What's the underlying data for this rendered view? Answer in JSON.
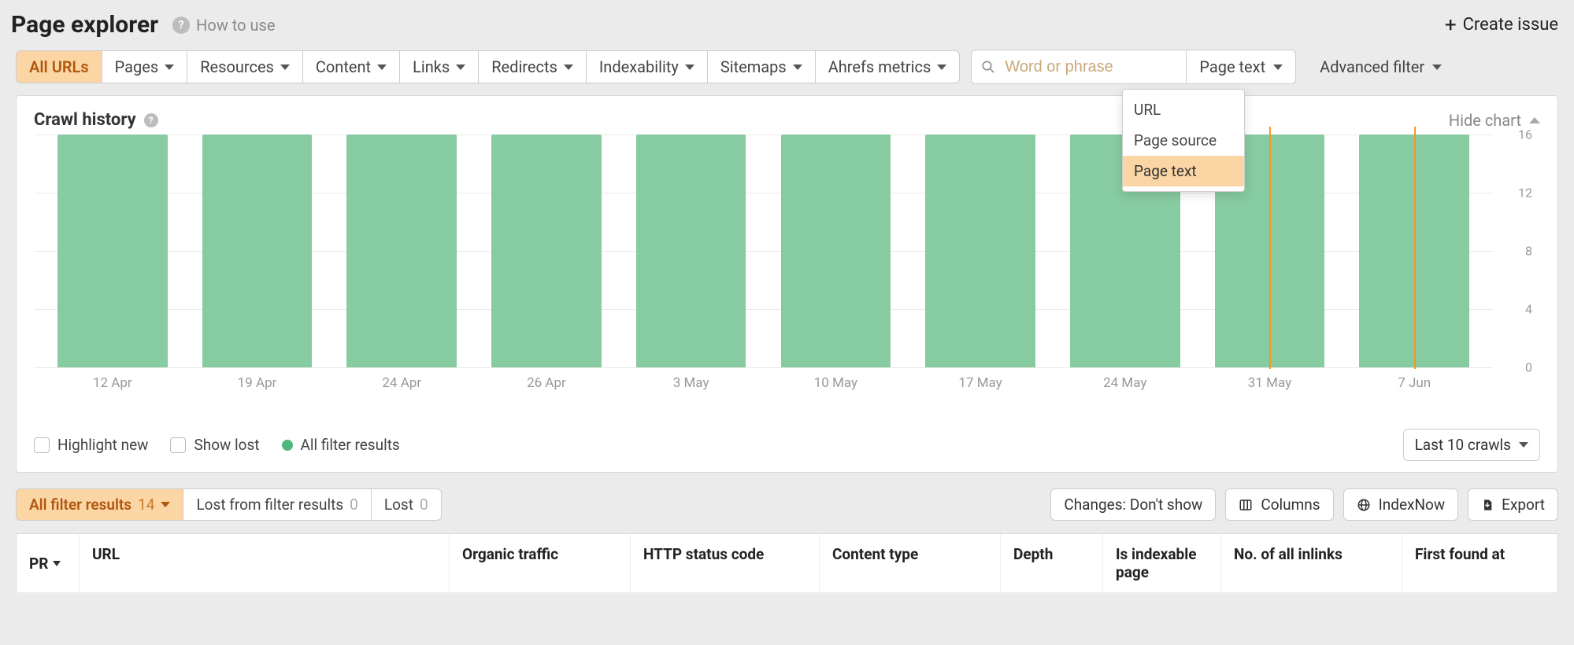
{
  "header": {
    "title": "Page explorer",
    "how_to_use": "How to use",
    "create_issue": "Create issue"
  },
  "filters": {
    "all_urls": "All URLs",
    "items": [
      "Pages",
      "Resources",
      "Content",
      "Links",
      "Redirects",
      "Indexability",
      "Sitemaps",
      "Ahrefs metrics"
    ],
    "search_placeholder": "Word or phrase",
    "scope_selected": "Page text",
    "scope_options": [
      "URL",
      "Page source",
      "Page text"
    ],
    "advanced_filter": "Advanced filter"
  },
  "chart_panel": {
    "title": "Crawl history",
    "hide_chart": "Hide chart",
    "highlight_new": "Highlight new",
    "show_lost": "Show lost",
    "all_filter_results": "All filter results",
    "crawls_select": "Last 10 crawls"
  },
  "chart_data": {
    "type": "bar",
    "categories": [
      "12 Apr",
      "19 Apr",
      "24 Apr",
      "26 Apr",
      "3 May",
      "10 May",
      "17 May",
      "24 May",
      "31 May",
      "7 Jun"
    ],
    "values": [
      16,
      16,
      16,
      16,
      16,
      16,
      16,
      16,
      16,
      16
    ],
    "markers": [
      8,
      9
    ],
    "ylim": [
      0,
      16
    ],
    "yticks": [
      0,
      4,
      8,
      12,
      16
    ],
    "title": "Crawl history",
    "xlabel": "",
    "ylabel": ""
  },
  "results": {
    "all_filter_results_label": "All filter results",
    "all_filter_results_count": "14",
    "lost_from_filter_label": "Lost from filter results",
    "lost_from_filter_count": "0",
    "lost_label": "Lost",
    "lost_count": "0",
    "changes_btn": "Changes: Don't show",
    "columns_btn": "Columns",
    "indexnow_btn": "IndexNow",
    "export_btn": "Export"
  },
  "table": {
    "columns": {
      "pr": "PR",
      "url": "URL",
      "organic_traffic": "Organic traffic",
      "http_status": "HTTP status code",
      "content_type": "Content type",
      "depth": "Depth",
      "is_indexable": "Is indexable page",
      "inlinks": "No. of all inlinks",
      "first_found": "First found at"
    }
  }
}
